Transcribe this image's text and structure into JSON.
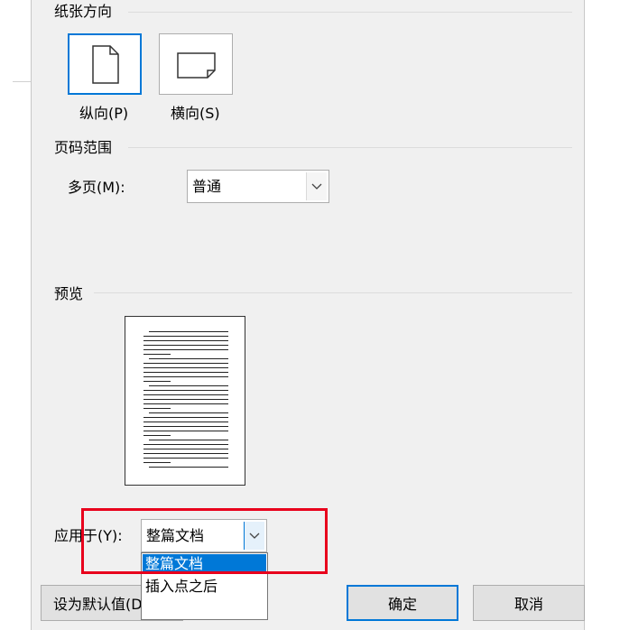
{
  "orientation": {
    "heading": "纸张方向",
    "portrait_label": "纵向(P)",
    "landscape_label": "横向(S)"
  },
  "page_range": {
    "heading": "页码范围",
    "multiple_pages_label": "多页(M):",
    "multiple_pages_value": "普通"
  },
  "preview": {
    "heading": "预览"
  },
  "apply_to": {
    "label": "应用于(Y):",
    "value": "整篇文档",
    "options": [
      "整篇文档",
      "插入点之后"
    ]
  },
  "buttons": {
    "set_default": "设为默认值(D)",
    "ok": "确定",
    "cancel": "取消"
  },
  "colors": {
    "accent": "#0078d7",
    "highlight": "#e8001c",
    "dialog_bg": "#f0f0f0"
  }
}
